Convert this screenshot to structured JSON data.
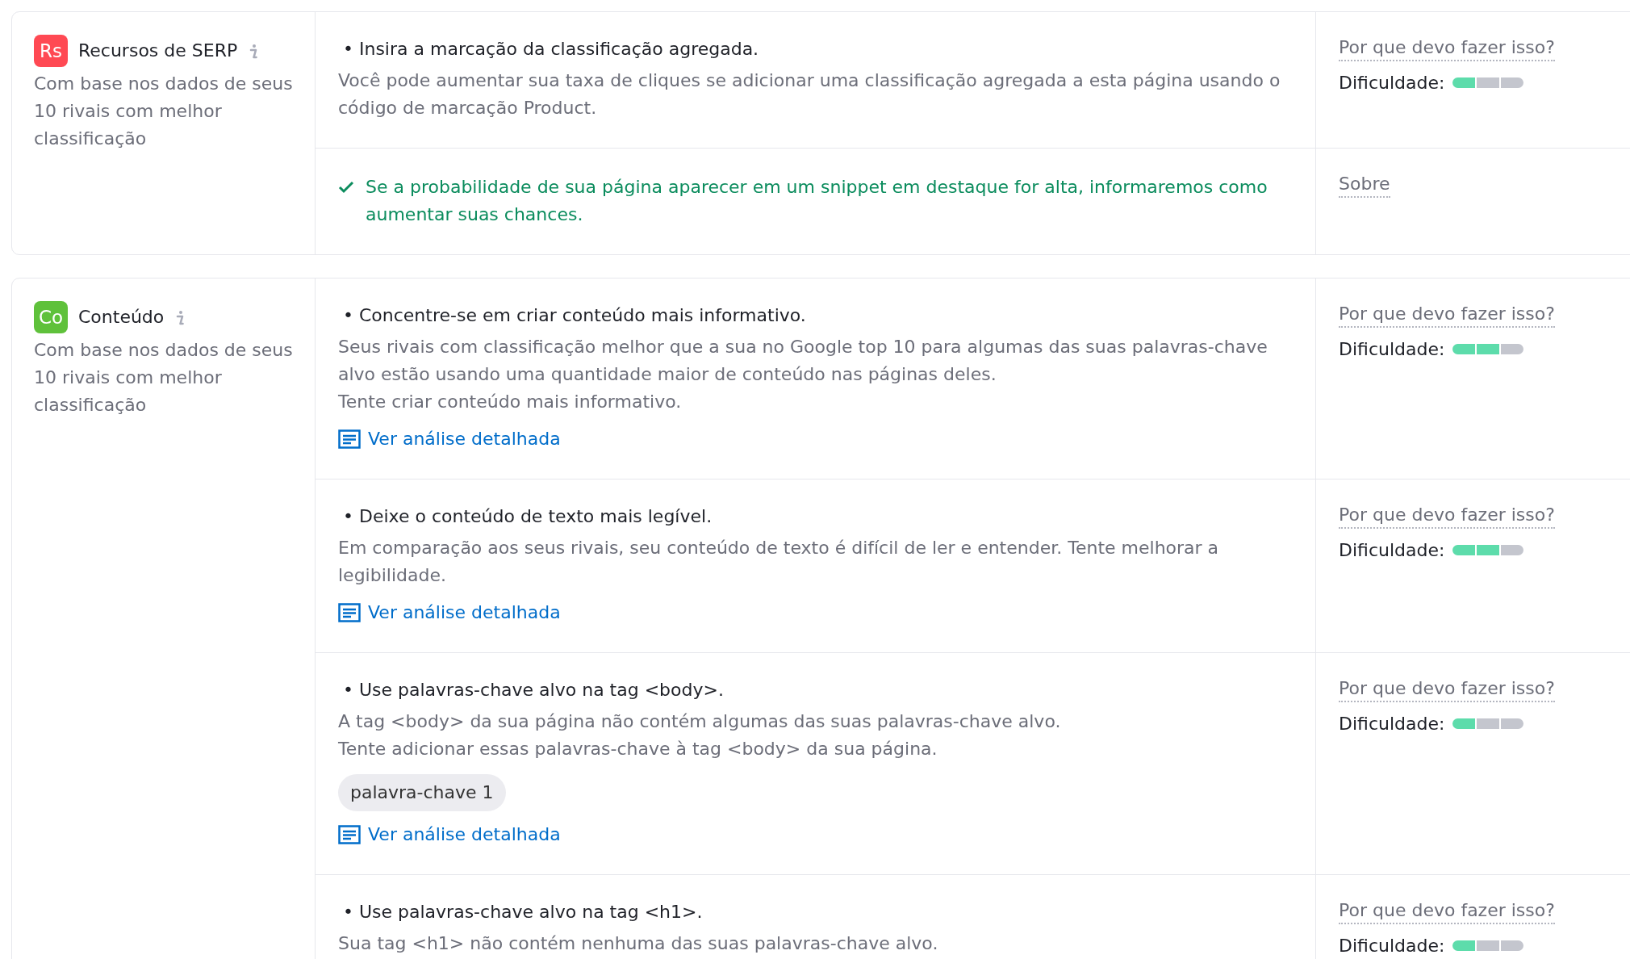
{
  "sections": [
    {
      "badge": "Rs",
      "color": "#ff4953",
      "title": "Recursos de SERP",
      "description": "Com base nos dados de seus 10 rivais com melhor classificação",
      "items": [
        {
          "kind": "task",
          "heading": "• Insira a marcação da classificação agregada.",
          "paragraphs": [
            "Você pode aumentar sua taxa de cliques se adicionar uma classificação agregada a esta página usando o código de marcação Product."
          ],
          "aside": {
            "link": "Por que devo fazer isso?",
            "difficulty_label": "Dificuldade:",
            "level": 0.33
          }
        },
        {
          "kind": "done",
          "paragraphs": [
            "Se a probabilidade de sua página aparecer em um snippet em destaque for alta, informaremos como aumentar suas chances."
          ],
          "aside": {
            "link": "Sobre"
          }
        }
      ]
    },
    {
      "badge": "Co",
      "color": "#5fc13b",
      "title": "Conteúdo",
      "description": "Com base nos dados de seus 10 rivais com melhor classificação",
      "items": [
        {
          "kind": "task",
          "heading": "• Concentre-se em criar conteúdo mais informativo.",
          "paragraphs": [
            "Seus rivais com classificação melhor que a sua no Google top 10 para algumas das suas palavras-chave alvo estão usando uma quantidade maior de conteúdo nas páginas deles.",
            "Tente criar conteúdo mais informativo."
          ],
          "detail_link": "Ver análise detalhada",
          "aside": {
            "link": "Por que devo fazer isso?",
            "difficulty_label": "Dificuldade:",
            "level": 0.67
          }
        },
        {
          "kind": "task",
          "heading": "• Deixe o conteúdo de texto mais legível.",
          "paragraphs": [
            "Em comparação aos seus rivais, seu conteúdo de texto é difícil de ler e entender. Tente melhorar a legibilidade."
          ],
          "detail_link": "Ver análise detalhada",
          "aside": {
            "link": "Por que devo fazer isso?",
            "difficulty_label": "Dificuldade:",
            "level": 0.67
          }
        },
        {
          "kind": "task",
          "heading": "• Use palavras-chave alvo na tag <body>.",
          "paragraphs": [
            "A tag <body> da sua página não contém algumas das suas palavras-chave alvo.",
            "Tente adicionar essas palavras-chave à tag <body> da sua página."
          ],
          "keywords": [
            "palavra-chave 1"
          ],
          "detail_link": "Ver análise detalhada",
          "aside": {
            "link": "Por que devo fazer isso?",
            "difficulty_label": "Dificuldade:",
            "level": 0.33
          }
        },
        {
          "kind": "task",
          "heading": "• Use palavras-chave alvo na tag <h1>.",
          "paragraphs": [
            "Sua tag <h1> não contém nenhuma das suas palavras-chave alvo."
          ],
          "aside": {
            "link": "Por que devo fazer isso?",
            "difficulty_label": "Dificuldade:",
            "level": 0.33
          }
        }
      ]
    }
  ]
}
